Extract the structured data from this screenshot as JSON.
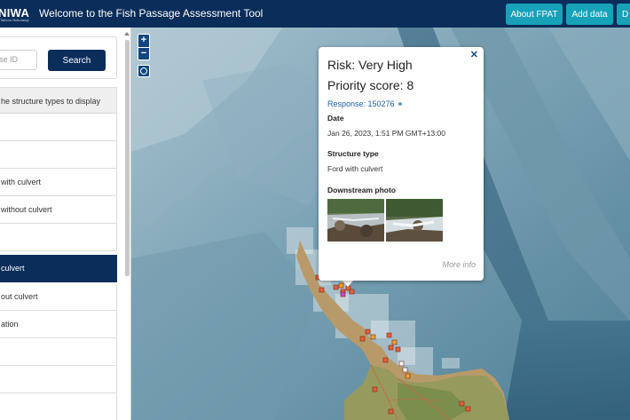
{
  "header": {
    "logo_text": "NIWA",
    "logo_sub": "Taihoro Nukurangi",
    "title": "Welcome to the Fish Passage Assessment Tool",
    "buttons": {
      "about": "About FPAT",
      "add_data": "Add data",
      "third": "D"
    },
    "colors": {
      "bar": "#0b2d5a",
      "button": "#17a2b8"
    }
  },
  "sidebar": {
    "search": {
      "placeholder": "se ID",
      "button": "Search"
    },
    "filter_header": "he structure types to display",
    "rows": [
      {
        "label": "",
        "active": false
      },
      {
        "label": "",
        "active": false
      },
      {
        "label": " with culvert",
        "active": false
      },
      {
        "label": " without culvert",
        "active": false
      },
      {
        "label": "",
        "active": false
      },
      {
        "label": " culvert",
        "active": true
      },
      {
        "label": "out culvert",
        "active": false
      },
      {
        "label": "ation",
        "active": false
      },
      {
        "label": "",
        "active": false
      },
      {
        "label": "",
        "active": false
      },
      {
        "label": "",
        "active": false
      }
    ]
  },
  "map": {
    "controls": {
      "zoom_in": "+",
      "zoom_out": "−",
      "locate_icon": "locate-icon"
    },
    "popup": {
      "risk": "Risk: Very High",
      "priority": "Priority score: 8",
      "response": "Response: 150276",
      "date_label": "Date",
      "date_value": "Jan 26, 2023, 1:51 PM GMT+13:00",
      "structure_label": "Structure type",
      "structure_value": "Ford with culvert",
      "photo_label": "Downstream photo",
      "more_info": "More info",
      "close_icon": "close-icon",
      "link_icon": "link-icon"
    }
  }
}
